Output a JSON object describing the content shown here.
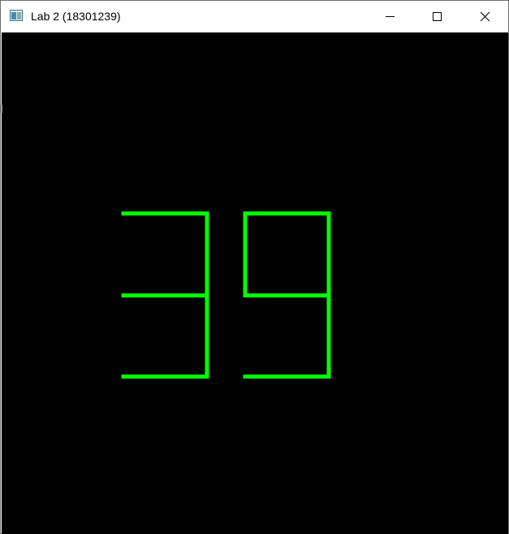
{
  "window": {
    "title": "Lab 2 (18301239)",
    "icon": "app-window-icon",
    "controls": {
      "minimize_icon": "minimize-icon",
      "maximize_icon": "maximize-icon",
      "close_icon": "close-icon"
    }
  },
  "canvas": {
    "background_color": "#000000",
    "display": {
      "value": "39",
      "digits": [
        "3",
        "9"
      ],
      "segment_color": "#00ff00"
    }
  }
}
